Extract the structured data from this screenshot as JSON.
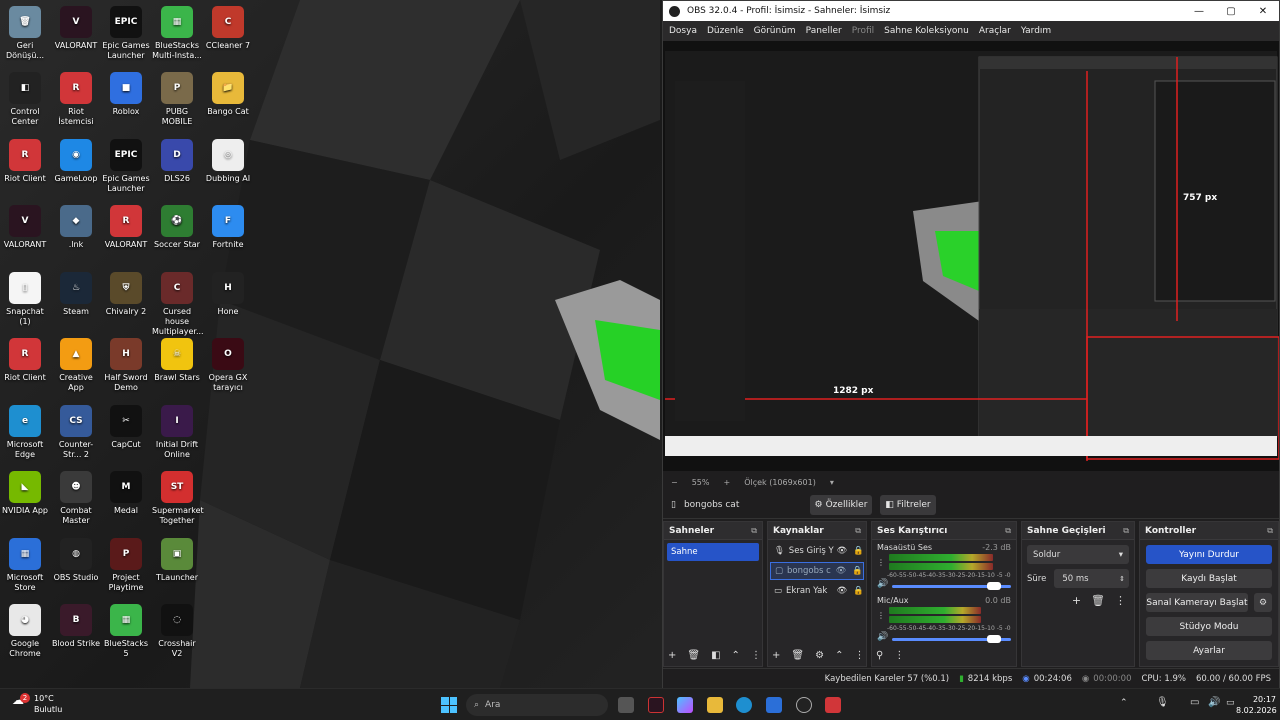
{
  "desktop_icons": [
    {
      "label": "Geri Dönüşü...",
      "color": "#6a8aa0",
      "glyph": "🗑"
    },
    {
      "label": "VALORANT",
      "color": "#2a1420",
      "glyph": "V"
    },
    {
      "label": "Epic Games Launcher",
      "color": "#111",
      "glyph": "EPIC"
    },
    {
      "label": "BlueStacks Multi-Insta...",
      "color": "#3bb54a",
      "glyph": "▦"
    },
    {
      "label": "CCleaner 7",
      "color": "#c0392b",
      "glyph": "C"
    },
    {
      "label": "Control Center",
      "color": "#222",
      "glyph": "◧"
    },
    {
      "label": "Riot İstemcisi",
      "color": "#d13639",
      "glyph": "R"
    },
    {
      "label": "Roblox",
      "color": "#2f6fe0",
      "glyph": "■"
    },
    {
      "label": "PUBG MOBILE",
      "color": "#7a6a4a",
      "glyph": "P"
    },
    {
      "label": "Bango Cat",
      "color": "#e8b93a",
      "glyph": "📁"
    },
    {
      "label": "Riot Client",
      "color": "#d13639",
      "glyph": "R"
    },
    {
      "label": "GameLoop",
      "color": "#1e88e5",
      "glyph": "◉"
    },
    {
      "label": "Epic Games Launcher",
      "color": "#111",
      "glyph": "EPIC"
    },
    {
      "label": "DLS26",
      "color": "#3949ab",
      "glyph": "D"
    },
    {
      "label": "Dubbing AI",
      "color": "#eee",
      "glyph": "◎"
    },
    {
      "label": "VALORANT",
      "color": "#2a1420",
      "glyph": "V"
    },
    {
      "label": ".lnk",
      "color": "#4a6a8a",
      "glyph": "◆"
    },
    {
      "label": "VALORANT",
      "color": "#d13639",
      "glyph": "R"
    },
    {
      "label": "Soccer Star",
      "color": "#2e7d32",
      "glyph": "⚽"
    },
    {
      "label": "Fortnite",
      "color": "#2d8cf0",
      "glyph": "F"
    },
    {
      "label": "Snapchat (1)",
      "color": "#f5f5f5",
      "glyph": "▯"
    },
    {
      "label": "Steam",
      "color": "#1b2838",
      "glyph": "♨"
    },
    {
      "label": "Chivalry 2",
      "color": "#5a4a2a",
      "glyph": "⛨"
    },
    {
      "label": "Cursed house Multiplayer...",
      "color": "#6a2a2a",
      "glyph": "C"
    },
    {
      "label": "Hone",
      "color": "#222",
      "glyph": "H"
    },
    {
      "label": "Riot Client",
      "color": "#d13639",
      "glyph": "R"
    },
    {
      "label": "Creative App",
      "color": "#f39c12",
      "glyph": "▲"
    },
    {
      "label": "Half Sword Demo",
      "color": "#7a3a2a",
      "glyph": "H"
    },
    {
      "label": "Brawl Stars",
      "color": "#f1c40f",
      "glyph": "☠"
    },
    {
      "label": "Opera GX tarayıcı",
      "color": "#3a0a14",
      "glyph": "O"
    },
    {
      "label": "Microsoft Edge",
      "color": "#1e8fd0",
      "glyph": "e"
    },
    {
      "label": "Counter-Str... 2",
      "color": "#355a9a",
      "glyph": "CS"
    },
    {
      "label": "CapCut",
      "color": "#111",
      "glyph": "✂"
    },
    {
      "label": "Initial Drift Online",
      "color": "#3a1a4a",
      "glyph": "I"
    },
    {
      "label": "",
      "color": "transparent",
      "glyph": ""
    },
    {
      "label": "NVIDIA App",
      "color": "#76b900",
      "glyph": "◣"
    },
    {
      "label": "Combat Master",
      "color": "#3a3a3a",
      "glyph": "☻"
    },
    {
      "label": "Medal",
      "color": "#111",
      "glyph": "M"
    },
    {
      "label": "Supermarket Together",
      "color": "#d32f2f",
      "glyph": "ST"
    },
    {
      "label": "",
      "color": "transparent",
      "glyph": ""
    },
    {
      "label": "Microsoft Store",
      "color": "#2b6fd8",
      "glyph": "▦"
    },
    {
      "label": "OBS Studio",
      "color": "#222",
      "glyph": "◍"
    },
    {
      "label": "Project Playtime",
      "color": "#5a1a1a",
      "glyph": "P"
    },
    {
      "label": "TLauncher",
      "color": "#5a8a3a",
      "glyph": "▣"
    },
    {
      "label": "",
      "color": "transparent",
      "glyph": ""
    },
    {
      "label": "Google Chrome",
      "color": "#e8e8e8",
      "glyph": "◕"
    },
    {
      "label": "Blood Strike",
      "color": "#3a1a2a",
      "glyph": "B"
    },
    {
      "label": "BlueStacks 5",
      "color": "#3bb54a",
      "glyph": "▦"
    },
    {
      "label": "Crosshair V2",
      "color": "#111",
      "glyph": "◌"
    }
  ],
  "obs": {
    "title": "OBS 32.0.4 - Profil: İsimsiz - Sahneler: İsimsiz",
    "menu": [
      "Dosya",
      "Düzenle",
      "Görünüm",
      "Paneller",
      "Profil",
      "Sahne Koleksiyonu",
      "Araçlar",
      "Yardım"
    ],
    "preview_labels": {
      "width_label": "1282 px",
      "height_label": "757 px"
    },
    "zoom": "55%",
    "scale": "Ölçek (1069x601)",
    "source_name": "bongobs cat",
    "properties_btn": "Özellikler",
    "filters_btn": "Filtreler",
    "scenes": {
      "title": "Sahneler",
      "items": [
        "Sahne"
      ]
    },
    "sources": {
      "title": "Kaynaklar",
      "items": [
        "Ses Giriş Y",
        "bongobs c",
        "Ekran Yak"
      ]
    },
    "mixer": {
      "title": "Ses Karıştırıcı",
      "channels": [
        {
          "name": "Masaüstü Ses",
          "db": "-2.3 dB",
          "level": 0.85
        },
        {
          "name": "Mic/Aux",
          "db": "0.0 dB",
          "level": 0.75
        }
      ],
      "scale": "-60-55-50-45-40-35-30-25-20-15-10 -5 -0"
    },
    "transitions": {
      "title": "Sahne Geçişleri",
      "selected": "Soldur",
      "duration_label": "Süre",
      "duration": "50 ms"
    },
    "controls": {
      "title": "Kontroller",
      "buttons": [
        "Yayını Durdur",
        "Kaydı Başlat",
        "Sanal Kamerayı Başlat",
        "Stüdyo Modu",
        "Ayarlar"
      ]
    },
    "status": {
      "dropped": "Kaybedilen Kareler 57 (%0.1)",
      "bitrate": "8214 kbps",
      "stream_time": "00:24:06",
      "rec_time": "00:00:00",
      "cpu": "CPU: 1.9%",
      "fps": "60.00 / 60.00 FPS"
    }
  },
  "taskbar": {
    "weather_temp": "10°C",
    "weather_desc": "Bulutlu",
    "weather_badge": "2",
    "search_placeholder": "Ara",
    "time": "20:17",
    "date": "8.02.2026"
  }
}
